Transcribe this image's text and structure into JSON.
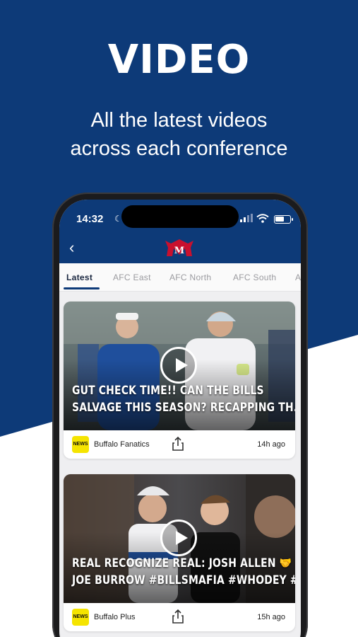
{
  "promo": {
    "title": "VIDEO",
    "subtitle_line1": "All the latest videos",
    "subtitle_line2": "across each conference"
  },
  "status_bar": {
    "time": "14:32"
  },
  "header": {
    "logo": "M"
  },
  "tabs": [
    {
      "label": "Latest",
      "active": true
    },
    {
      "label": "AFC East"
    },
    {
      "label": "AFC North"
    },
    {
      "label": "AFC South"
    },
    {
      "label": "A"
    }
  ],
  "videos": [
    {
      "title_line1": "GUT CHECK TIME!! CAN THE BILLS",
      "title_line2": "SALVAGE THIS SEASON? RECAPPING TH...",
      "source_badge": "NEWS",
      "source": "Buffalo Fanatics",
      "time_ago": "14h ago"
    },
    {
      "title_line1": "REAL RECOGNIZE REAL: JOSH ALLEN 🤝",
      "title_line2": "JOE BURROW #BILLSMAFIA #WHODEY #...",
      "source_badge": "NEWS",
      "source": "Buffalo Plus",
      "time_ago": "15h ago"
    }
  ],
  "colors": {
    "brand_navy": "#0d3a78",
    "accent_red": "#c8102e",
    "badge_yellow": "#f5e400"
  }
}
